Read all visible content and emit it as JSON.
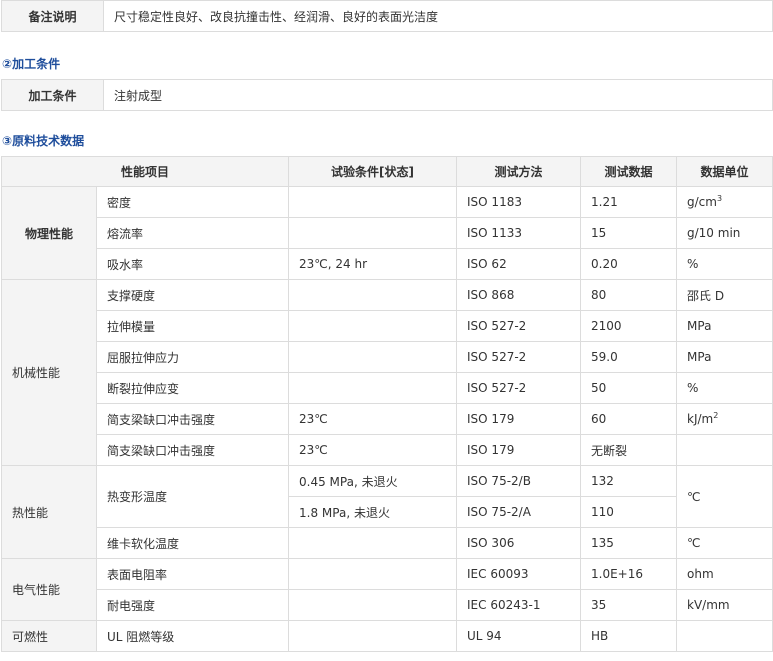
{
  "notes": {
    "label": "备注说明",
    "value": "尺寸稳定性良好、改良抗撞击性、经润滑、良好的表面光洁度"
  },
  "processing": {
    "section_title": "②加工条件",
    "label": "加工条件",
    "value": "注射成型"
  },
  "tech": {
    "section_title": "③原料技术数据",
    "headers": {
      "property": "性能项目",
      "condition": "试验条件[状态]",
      "method": "测试方法",
      "data": "测试数据",
      "unit": "数据单位"
    },
    "categories": {
      "physical": "物理性能",
      "mechanical": "机械性能",
      "thermal": "热性能",
      "electrical": "电气性能",
      "flammability": "可燃性"
    },
    "rows": [
      {
        "item": "密度",
        "condition": "",
        "method": "ISO 1183",
        "value": "1.21",
        "unit": "g/cm",
        "unit_sup": "3"
      },
      {
        "item": "熔流率",
        "condition": "",
        "method": "ISO 1133",
        "value": "15",
        "unit": "g/10 min",
        "unit_sup": ""
      },
      {
        "item": "吸水率",
        "condition": "23℃, 24 hr",
        "method": "ISO 62",
        "value": "0.20",
        "unit": "%",
        "unit_sup": ""
      },
      {
        "item": "支撑硬度",
        "condition": "",
        "method": "ISO 868",
        "value": "80",
        "unit": "邵氏 D",
        "unit_sup": ""
      },
      {
        "item": "拉伸模量",
        "condition": "",
        "method": "ISO 527-2",
        "value": "2100",
        "unit": "MPa",
        "unit_sup": ""
      },
      {
        "item": "屈服拉伸应力",
        "condition": "",
        "method": "ISO 527-2",
        "value": "59.0",
        "unit": "MPa",
        "unit_sup": ""
      },
      {
        "item": "断裂拉伸应变",
        "condition": "",
        "method": "ISO 527-2",
        "value": "50",
        "unit": "%",
        "unit_sup": ""
      },
      {
        "item": "简支梁缺口冲击强度",
        "condition": "23℃",
        "method": "ISO 179",
        "value": "60",
        "unit": "kJ/m",
        "unit_sup": "2"
      },
      {
        "item": "简支梁缺口冲击强度",
        "condition": "23℃",
        "method": "ISO 179",
        "value": "无断裂",
        "unit": "",
        "unit_sup": ""
      },
      {
        "item": "热变形温度",
        "condition": "0.45 MPa, 未退火",
        "method": "ISO 75-2/B",
        "value": "132",
        "unit": "℃",
        "unit_sup": ""
      },
      {
        "item": "",
        "condition": "1.8 MPa, 未退火",
        "method": "ISO 75-2/A",
        "value": "110",
        "unit": "",
        "unit_sup": ""
      },
      {
        "item": "维卡软化温度",
        "condition": "",
        "method": "ISO 306",
        "value": "135",
        "unit": "℃",
        "unit_sup": ""
      },
      {
        "item": "表面电阻率",
        "condition": "",
        "method": "IEC 60093",
        "value": "1.0E+16",
        "unit": "ohm",
        "unit_sup": ""
      },
      {
        "item": "耐电强度",
        "condition": "",
        "method": "IEC 60243-1",
        "value": "35",
        "unit": "kV/mm",
        "unit_sup": ""
      },
      {
        "item": "UL 阻燃等级",
        "condition": "",
        "method": "UL 94",
        "value": "HB",
        "unit": "",
        "unit_sup": ""
      }
    ]
  }
}
